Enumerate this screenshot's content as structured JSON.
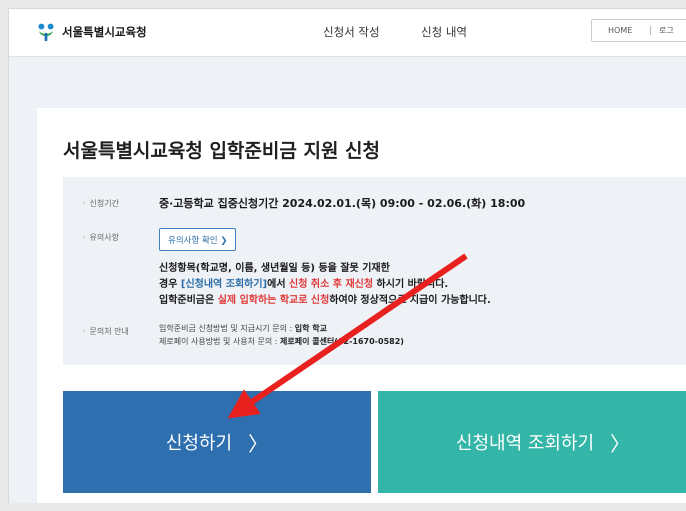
{
  "header": {
    "logo_text": "서울특별시교육청",
    "nav": [
      "신청서 작성",
      "신청 내역"
    ],
    "util": {
      "home": "HOME",
      "login": "로그"
    }
  },
  "page": {
    "title": "서울특별시교육청 입학준비금 지원 신청"
  },
  "info": {
    "period_label": "신청기간",
    "period_text": "중·고등학교 집중신청기간 2024.02.01.(목) 09:00 - 02.06.(화) 18:00",
    "notice_label": "유의사항",
    "notice_button": "유의사항 확인 ❯",
    "line1": "신청항목(학교명, 이름, 생년월일 등) 등을 잘못 기재한",
    "line2_a": "경우 ",
    "line2_b": "[신청내역 조회하기]",
    "line2_c": "에서 ",
    "line2_d": "신청 취소 후 재신청",
    "line2_e": " 하시기 바랍니다.",
    "line3_a": "입학준비금은 ",
    "line3_b": "실제 입학하는 학교로 신청",
    "line3_c": "하여야 정상적으로 지급이 가능합니다.",
    "contact_label": "문의처 안내",
    "contact1_a": "입학준비금 신청방법 및 지급시기 문의 : ",
    "contact1_b": "입학 학교",
    "contact2_a": "제로페이 사용방법 및 사용처 문의 : ",
    "contact2_b": "제로페이 콜센터(02-1670-0582)"
  },
  "buttons": {
    "apply": "신청하기",
    "history": "신청내역 조회하기",
    "chevron": "〉"
  },
  "colors": {
    "primary": "#2e6fb0",
    "secondary": "#33b5a7",
    "annotation": "#e8201e"
  }
}
